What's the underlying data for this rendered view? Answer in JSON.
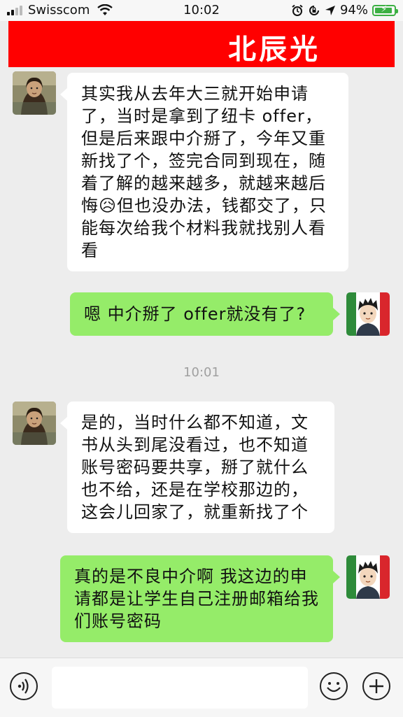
{
  "status_bar": {
    "carrier": "Swisscom",
    "time": "10:02",
    "battery_percent": "94%",
    "battery_level": 0.94,
    "icons": [
      "signal-icon",
      "wifi-icon",
      "alarm-icon",
      "orientation-lock-icon",
      "location-arrow-icon",
      "battery-charging-icon"
    ]
  },
  "header": {
    "title": "北辰光",
    "background": "#ff0000"
  },
  "messages": [
    {
      "sender": "other",
      "text": "其实我从去年大三就开始申请了，当时是拿到了纽卡 offer，但是后来跟中介掰了，今年又重新找了个，签完合同到现在，随着了解的越来越多，就越来越后悔😥但也没办法，钱都交了，只能每次给我个材料我就找别人看看"
    },
    {
      "sender": "me",
      "text": "嗯  中介掰了 offer就没有了?"
    },
    {
      "sender": "other",
      "text": "是的，当时什么都不知道，文书从头到尾没看过，也不知道账号密码要共享，掰了就什么也不给，还是在学校那边的，这会儿回家了，就重新找了个"
    },
    {
      "sender": "me",
      "text": "真的是不良中介啊 我这边的申请都是让学生自己注册邮箱给我们账号密码"
    }
  ],
  "timestamp": "10:01",
  "input_bar": {
    "placeholder": "",
    "icons": [
      "voice-icon",
      "emoji-icon",
      "plus-icon"
    ]
  },
  "colors": {
    "outgoing_bubble": "#95ec69",
    "incoming_bubble": "#ffffff",
    "chat_background": "#ededed"
  }
}
